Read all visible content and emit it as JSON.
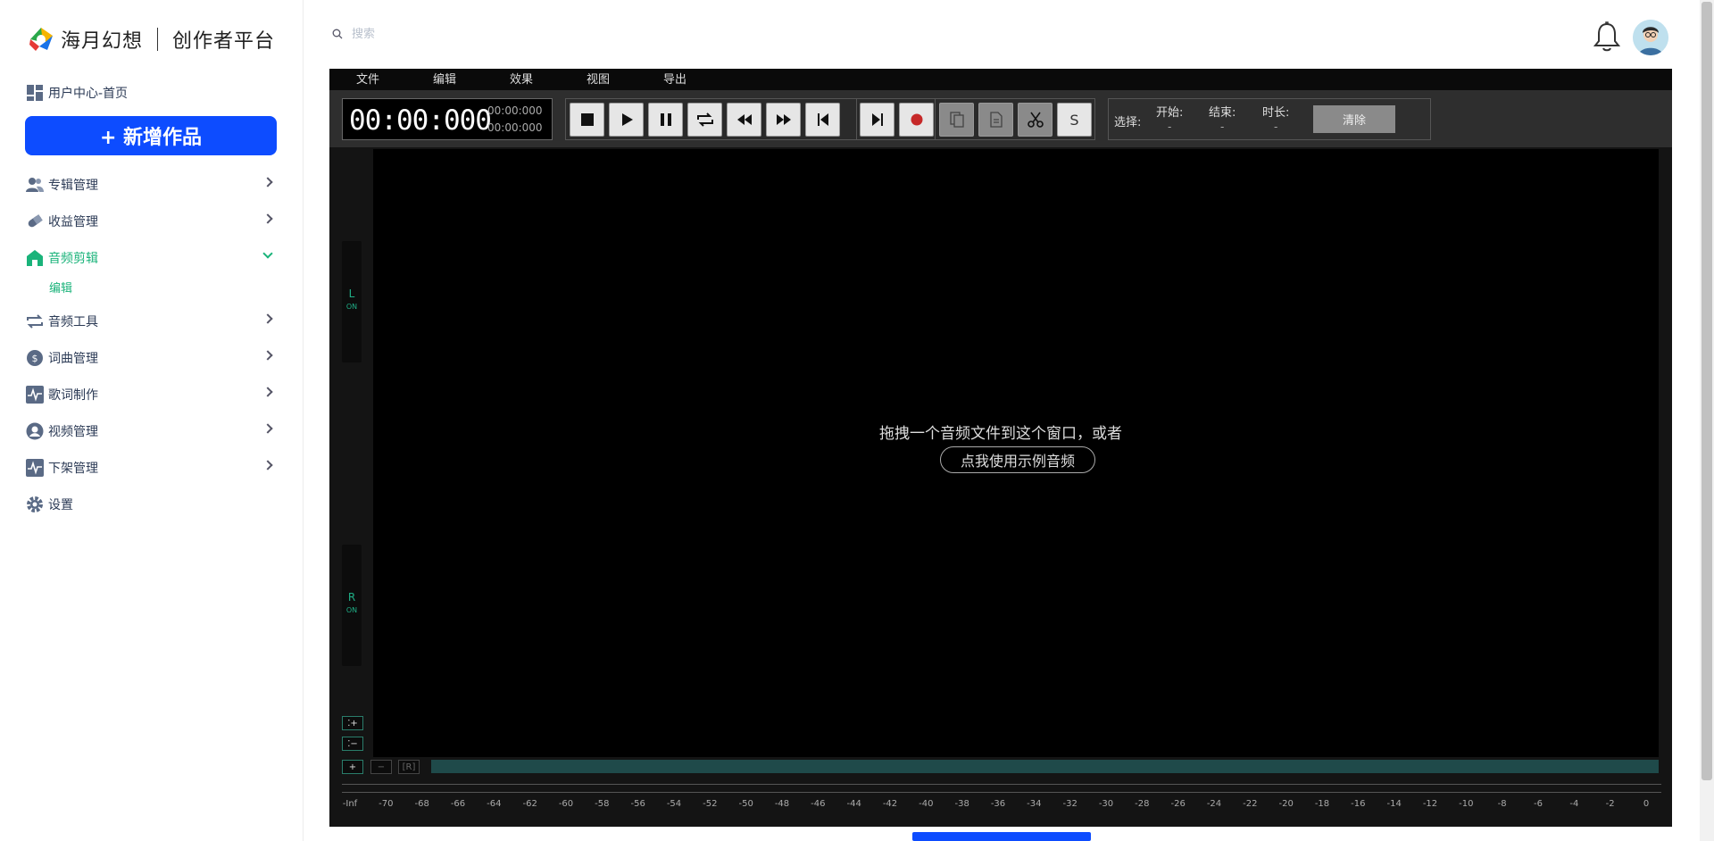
{
  "brand": {
    "name": "海月幻想",
    "sub": "创作者平台"
  },
  "sidebar": {
    "home": "用户中心-首页",
    "new_button": "+ 新增作品",
    "items": [
      {
        "label": "专辑管理",
        "icon": "users-icon"
      },
      {
        "label": "收益管理",
        "icon": "pill-icon"
      },
      {
        "label": "音频剪辑",
        "icon": "home-icon",
        "active": true,
        "sub": [
          "编辑"
        ]
      },
      {
        "label": "音频工具",
        "icon": "repeat-icon"
      },
      {
        "label": "词曲管理",
        "icon": "dollar-icon"
      },
      {
        "label": "歌词制作",
        "icon": "pulse-icon"
      },
      {
        "label": "视频管理",
        "icon": "user-circle-icon"
      },
      {
        "label": "下架管理",
        "icon": "pulse-icon"
      },
      {
        "label": "设置",
        "icon": "gear-icon",
        "no_chevron": true
      }
    ]
  },
  "header": {
    "search_placeholder": "搜索"
  },
  "editor": {
    "menu": [
      "文件",
      "编辑",
      "效果",
      "视图",
      "导出"
    ],
    "time_main": "00:00:000",
    "time_sub1": "00:00:000",
    "time_sub2": "00:00:000",
    "select_label": "选择:",
    "start_label": "开始:",
    "end_label": "结束:",
    "duration_label": "时长:",
    "start_val": "-",
    "end_val": "-",
    "duration_val": "-",
    "clear_label": "清除",
    "s_label": "S",
    "chan_l": "L",
    "chan_r": "R",
    "chan_on": "ON",
    "drop_text": "拖拽一个音频文件到这个窗口，或者",
    "sample_button": "点我使用示例音频",
    "zoom_in_v": "⁚+",
    "zoom_out_v": "⁚−",
    "zoom_in_h": "+",
    "zoom_out_h": "−",
    "zoom_reset": "[R]",
    "scale": [
      "-Inf",
      "-70",
      "-68",
      "-66",
      "-64",
      "-62",
      "-60",
      "-58",
      "-56",
      "-54",
      "-52",
      "-50",
      "-48",
      "-46",
      "-44",
      "-42",
      "-40",
      "-38",
      "-36",
      "-34",
      "-32",
      "-30",
      "-28",
      "-26",
      "-24",
      "-22",
      "-20",
      "-18",
      "-16",
      "-14",
      "-12",
      "-10",
      "-8",
      "-6",
      "-4",
      "-2",
      "0"
    ]
  },
  "colors": {
    "accent": "#0d4cff",
    "active": "#1ab37a",
    "teal": "#1fae86"
  }
}
